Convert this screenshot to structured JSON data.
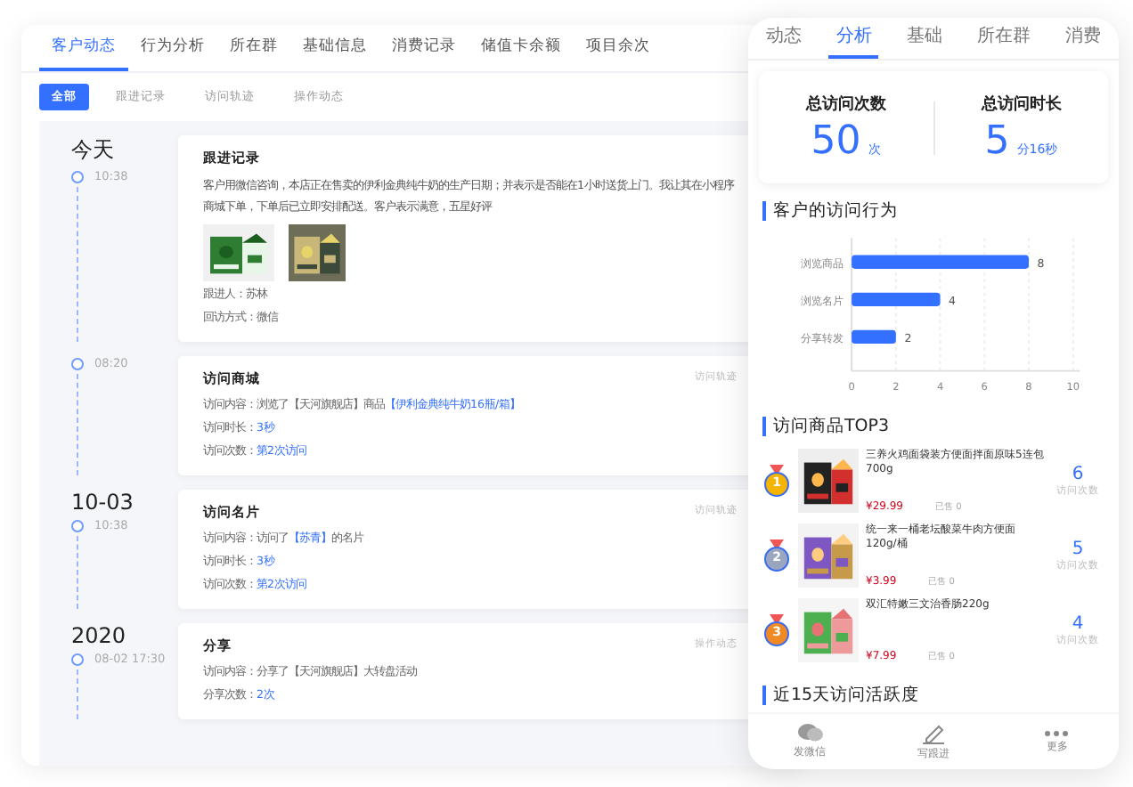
{
  "tabs": [
    {
      "label": "客户动态",
      "selected": true
    },
    {
      "label": "行为分析",
      "selected": false
    },
    {
      "label": "所在群",
      "selected": false
    },
    {
      "label": "基础信息",
      "selected": false
    },
    {
      "label": "消费记录",
      "selected": false
    },
    {
      "label": "储值卡余额",
      "selected": false
    },
    {
      "label": "项目余次",
      "selected": false
    }
  ],
  "filters": [
    {
      "label": "全部",
      "selected": true
    },
    {
      "label": "跟进记录",
      "selected": false
    },
    {
      "label": "访问轨迹",
      "selected": false
    },
    {
      "label": "操作动态",
      "selected": false
    }
  ],
  "timeline": [
    {
      "date": "今天",
      "entries": [
        {
          "time": "10:38",
          "card": {
            "kind": "followup",
            "title": "跟进记录",
            "text": "客户用微信咨询，本店正在售卖的伊利金典纯牛奶的生产日期；并表示是否能在1小时送货上门。我让其在小程序商城下单，下单后已立即安排配送。客户表示满意，五星好评",
            "fields": [
              {
                "label": "跟进人：",
                "parts": [
                  {
                    "text": "苏林",
                    "highlight": false
                  }
                ]
              },
              {
                "label": "回访方式：",
                "parts": [
                  {
                    "text": "微信",
                    "highlight": false
                  }
                ]
              }
            ]
          }
        },
        {
          "time": "08:20",
          "card": {
            "kind": "visit",
            "title": "访问商城",
            "tag": "访问轨迹",
            "fields": [
              {
                "label": "访问内容：",
                "parts": [
                  {
                    "text": "浏览了【天河旗舰店】商品",
                    "highlight": false
                  },
                  {
                    "text": "【伊利金典纯牛奶16瓶/箱】",
                    "highlight": true
                  }
                ]
              },
              {
                "label": "访问时长：",
                "parts": [
                  {
                    "text": "3秒",
                    "highlight": true
                  }
                ]
              },
              {
                "label": "访问次数：",
                "parts": [
                  {
                    "text": "第2次访问",
                    "highlight": true
                  }
                ]
              }
            ]
          }
        }
      ]
    },
    {
      "date": "10-03",
      "entries": [
        {
          "time": "10:38",
          "card": {
            "kind": "visit",
            "title": "访问名片",
            "tag": "访问轨迹",
            "fields": [
              {
                "label": "访问内容：",
                "parts": [
                  {
                    "text": "访问了",
                    "highlight": false
                  },
                  {
                    "text": "【苏青】",
                    "highlight": true
                  },
                  {
                    "text": "的名片",
                    "highlight": false
                  }
                ]
              },
              {
                "label": "访问时长：",
                "parts": [
                  {
                    "text": "3秒",
                    "highlight": true
                  }
                ]
              },
              {
                "label": "访问次数：",
                "parts": [
                  {
                    "text": "第2次访问",
                    "highlight": true
                  }
                ]
              }
            ]
          }
        }
      ]
    },
    {
      "date": "2020",
      "entries": [
        {
          "time": "08-02 17:30",
          "card": {
            "kind": "visit",
            "title": "分享",
            "tag": "操作动态",
            "fields": [
              {
                "label": "访问内容：",
                "parts": [
                  {
                    "text": "分享了【天河旗舰店】大转盘活动",
                    "highlight": false
                  }
                ]
              },
              {
                "label": "分享次数：",
                "parts": [
                  {
                    "text": "2次",
                    "highlight": true
                  }
                ]
              }
            ]
          }
        }
      ]
    }
  ],
  "phone": {
    "tabs": [
      {
        "label": "动态",
        "selected": false
      },
      {
        "label": "分析",
        "selected": true
      },
      {
        "label": "基础",
        "selected": false
      },
      {
        "label": "所在群",
        "selected": false
      },
      {
        "label": "消费",
        "selected": false
      }
    ],
    "stats": [
      {
        "label": "总访问次数",
        "value": "50",
        "unit": "次"
      },
      {
        "label": "总访问时长",
        "value": "5",
        "unit": "分16秒"
      }
    ],
    "behavior": {
      "title": "客户的访问行为",
      "chart_data": {
        "type": "bar",
        "orientation": "horizontal",
        "categories": [
          "浏览商品",
          "浏览名片",
          "分享转发"
        ],
        "values": [
          8,
          4,
          2
        ],
        "xlim": [
          0,
          10
        ],
        "xticks": [
          0,
          2,
          4,
          6,
          8,
          10
        ],
        "data_labels": true,
        "grid": true
      }
    },
    "top": {
      "title": "访问商品TOP3",
      "items": [
        {
          "rank": "1",
          "kind": "gold",
          "name": "三养火鸡面袋装方便面拌面原味5连包700g",
          "price": "¥29.99",
          "sold": "已售 0",
          "count": "6",
          "count_label": "访问次数"
        },
        {
          "rank": "2",
          "kind": "silver",
          "name": "统一来一桶老坛酸菜牛肉方便面120g/桶",
          "price": "¥3.99",
          "sold": "已售 0",
          "count": "5",
          "count_label": "访问次数"
        },
        {
          "rank": "3",
          "kind": "bronze",
          "name": "双汇特嫩三文治香肠220g",
          "price": "¥7.99",
          "sold": "已售 0",
          "count": "4",
          "count_label": "访问次数"
        }
      ]
    },
    "activity": {
      "title": "近15天访问活跃度"
    },
    "actions": [
      {
        "kind": "chat",
        "label": "发微信"
      },
      {
        "kind": "pen",
        "label": "写跟进"
      },
      {
        "kind": "more",
        "label": "更多"
      }
    ]
  }
}
